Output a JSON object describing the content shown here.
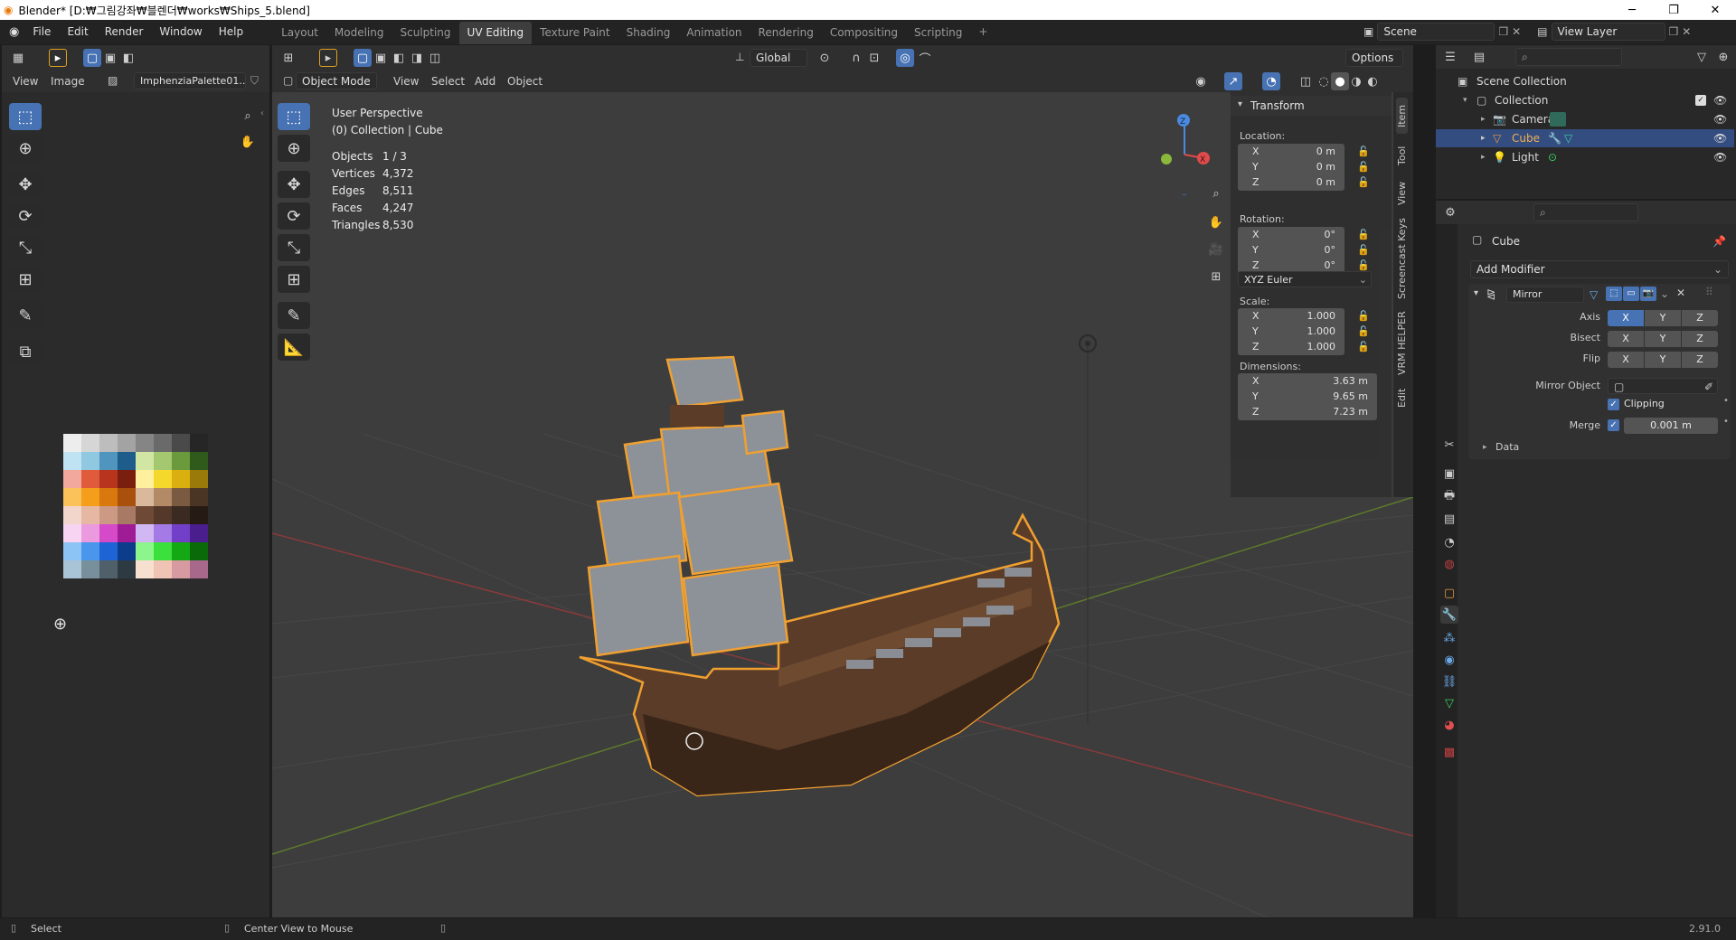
{
  "window": {
    "title": "Blender* [D:₩그림강좌₩블렌더₩works₩Ships_5.blend]",
    "minimize": "─",
    "maximize": "❐",
    "close": "✕"
  },
  "menus": [
    "File",
    "Edit",
    "Render",
    "Window",
    "Help"
  ],
  "workspaces": [
    "Layout",
    "Modeling",
    "Sculpting",
    "UV Editing",
    "Texture Paint",
    "Shading",
    "Animation",
    "Rendering",
    "Compositing",
    "Scripting"
  ],
  "active_workspace": "UV Editing",
  "scene": {
    "name": "Scene",
    "view_layer": "View Layer"
  },
  "image_editor": {
    "view": "View",
    "image": "Image",
    "image_name": "ImphenziaPalette01..."
  },
  "viewport_header": {
    "mode": "Object Mode",
    "view": "View",
    "select": "Select",
    "add": "Add",
    "object": "Object",
    "transform_orientation": "Global",
    "options": "Options"
  },
  "viewport_info": {
    "perspective": "User Perspective",
    "collection": "(0) Collection | Cube",
    "stats": [
      {
        "label": "Objects",
        "value": "1 / 3"
      },
      {
        "label": "Vertices",
        "value": "4,372"
      },
      {
        "label": "Edges",
        "value": "8,511"
      },
      {
        "label": "Faces",
        "value": "4,247"
      },
      {
        "label": "Triangles",
        "value": "8,530"
      }
    ]
  },
  "gizmo": {
    "z": "Z",
    "x": "X"
  },
  "npanel": {
    "title": "Transform",
    "location_label": "Location:",
    "location": [
      {
        "axis": "X",
        "value": "0 m"
      },
      {
        "axis": "Y",
        "value": "0 m"
      },
      {
        "axis": "Z",
        "value": "0 m"
      }
    ],
    "rotation_label": "Rotation:",
    "rotation": [
      {
        "axis": "X",
        "value": "0°"
      },
      {
        "axis": "Y",
        "value": "0°"
      },
      {
        "axis": "Z",
        "value": "0°"
      }
    ],
    "rotation_mode": "XYZ Euler",
    "scale_label": "Scale:",
    "scale": [
      {
        "axis": "X",
        "value": "1.000"
      },
      {
        "axis": "Y",
        "value": "1.000"
      },
      {
        "axis": "Z",
        "value": "1.000"
      }
    ],
    "dimensions_label": "Dimensions:",
    "dimensions": [
      {
        "axis": "X",
        "value": "3.63 m"
      },
      {
        "axis": "Y",
        "value": "9.65 m"
      },
      {
        "axis": "Z",
        "value": "7.23 m"
      }
    ],
    "tabs": [
      "Item",
      "Tool",
      "View",
      "Screencast Keys",
      "VRM HELPER",
      "Edit"
    ]
  },
  "outliner": {
    "root": "Scene Collection",
    "items": [
      {
        "name": "Collection",
        "icon": "collection-icon"
      },
      {
        "name": "Camera",
        "icon": "camera-icon"
      },
      {
        "name": "Cube",
        "icon": "mesh-icon"
      },
      {
        "name": "Light",
        "icon": "light-icon"
      }
    ]
  },
  "properties": {
    "object_name": "Cube",
    "add_modifier": "Add Modifier",
    "modifier_name": "Mirror",
    "axis_label": "Axis",
    "bisect_label": "Bisect",
    "flip_label": "Flip",
    "xyz": [
      "X",
      "Y",
      "Z"
    ],
    "mirror_object_label": "Mirror Object",
    "clipping_label": "Clipping",
    "merge_label": "Merge",
    "merge_value": "0.001 m",
    "data_label": "Data"
  },
  "statusbar": {
    "select": "Select",
    "center_view": "Center View to Mouse",
    "version": "2.91.0"
  },
  "palette": [
    [
      "#ededed",
      "#d6d6d6",
      "#bdbdbd",
      "#a3a3a3",
      "#858585",
      "#6a6a6a",
      "#4a4a4a",
      "#262626"
    ],
    [
      "#bfe3f2",
      "#8fc8e0",
      "#4f95bd",
      "#1e5c8c",
      "#d2e6a4",
      "#a4c870",
      "#6a9a3c",
      "#2f5a1c"
    ],
    [
      "#f2a89c",
      "#e05a3c",
      "#b8341c",
      "#7a1e10",
      "#fff0a0",
      "#f5d82c",
      "#d9b010",
      "#9a7a08"
    ],
    [
      "#fbc25a",
      "#f59e1c",
      "#d9780c",
      "#a8500c",
      "#d9b89c",
      "#b38a66",
      "#7a5a40",
      "#4a3424"
    ],
    [
      "#f2d6cc",
      "#e6b8a4",
      "#cc9a84",
      "#a87a66",
      "#6e4a36",
      "#54382a",
      "#3a2a22",
      "#261a14"
    ],
    [
      "#f7d4f2",
      "#ec9ae0",
      "#d44ac8",
      "#a01c96",
      "#d2b8f2",
      "#a47ae6",
      "#7240c8",
      "#4a1e8c"
    ],
    [
      "#8cc4f5",
      "#4a96ec",
      "#1e64d4",
      "#0e3c8c",
      "#8cf58c",
      "#3ce03c",
      "#14a814",
      "#0a6a0a"
    ],
    [
      "#a8c4d6",
      "#78909c",
      "#50606a",
      "#2e3a42",
      "#f7e0d0",
      "#f0c4b4",
      "#d69aa0",
      "#a8688c"
    ]
  ]
}
